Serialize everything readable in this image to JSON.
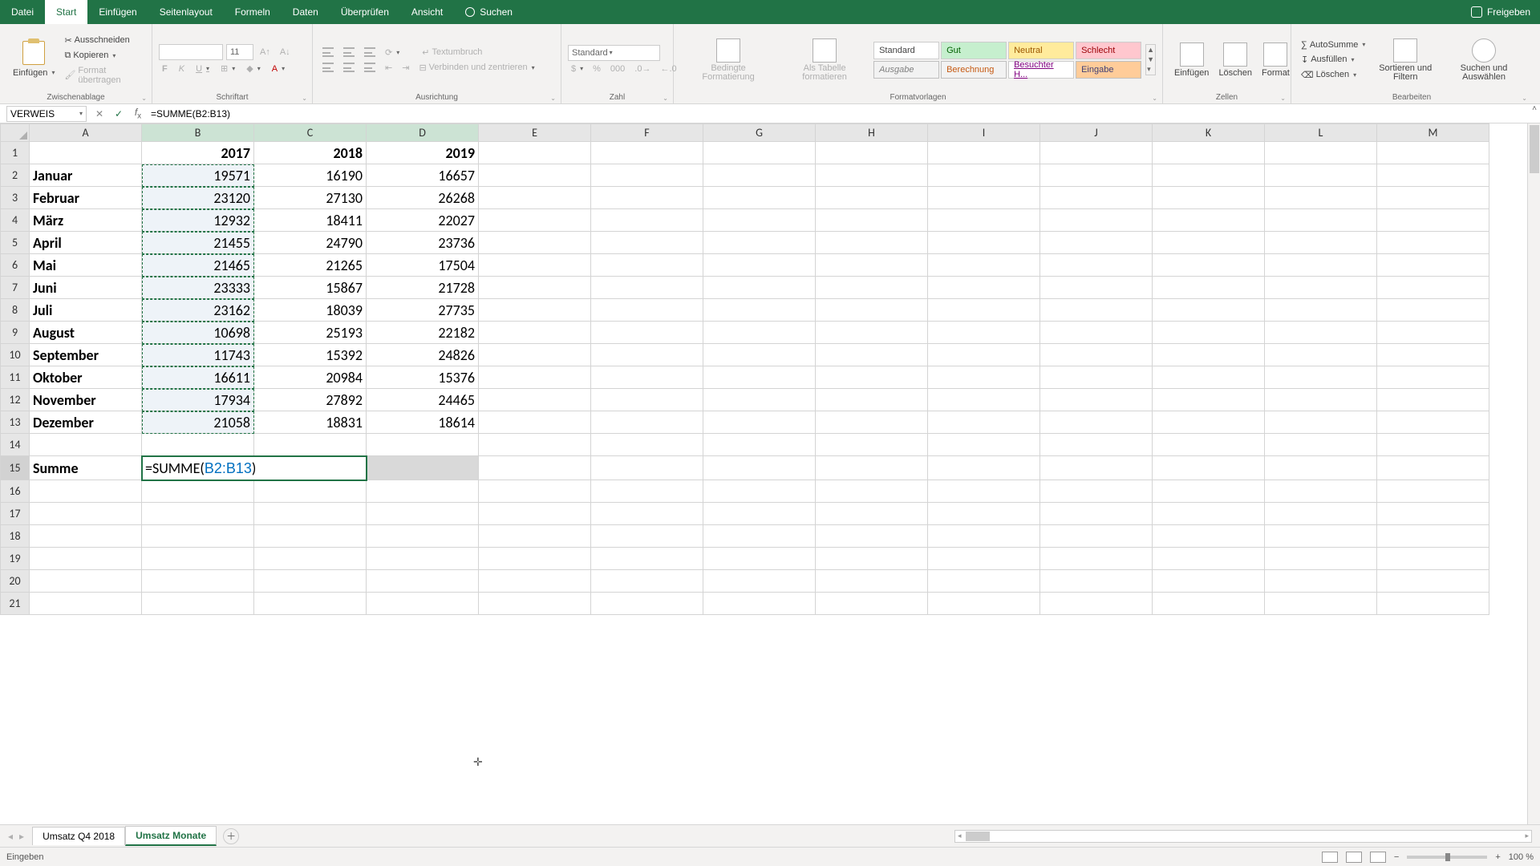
{
  "tabs": {
    "datei": "Datei",
    "start": "Start",
    "einfuegen": "Einfügen",
    "seitenlayout": "Seitenlayout",
    "formeln": "Formeln",
    "daten": "Daten",
    "ueberpruefen": "Überprüfen",
    "ansicht": "Ansicht",
    "suchen": "Suchen",
    "freigeben": "Freigeben"
  },
  "ribbon": {
    "clipboard": {
      "label": "Zwischenablage",
      "paste": "Einfügen",
      "ausschneiden": "Ausschneiden",
      "kopieren": "Kopieren",
      "format_uebertragen": "Format übertragen"
    },
    "font": {
      "label": "Schriftart",
      "size": "11",
      "bold": "F",
      "italic": "K",
      "underline": "U"
    },
    "align": {
      "label": "Ausrichtung",
      "textumbruch": "Textumbruch",
      "verbinden": "Verbinden und zentrieren"
    },
    "number": {
      "label": "Zahl",
      "format": "Standard"
    },
    "styles": {
      "label": "Formatvorlagen",
      "bedingte": "Bedingte Formatierung",
      "als_tabelle": "Als Tabelle formatieren",
      "standard": "Standard",
      "gut": "Gut",
      "neutral": "Neutral",
      "schlecht": "Schlecht",
      "ausgabe": "Ausgabe",
      "berechnung": "Berechnung",
      "besuchter": "Besuchter H...",
      "eingabe": "Eingabe"
    },
    "cells": {
      "label": "Zellen",
      "einfuegen": "Einfügen",
      "loeschen": "Löschen",
      "format": "Format"
    },
    "editing": {
      "label": "Bearbeiten",
      "autosumme": "AutoSumme",
      "ausfuellen": "Ausfüllen",
      "loeschen_btn": "Löschen",
      "sortieren": "Sortieren und Filtern",
      "suchen": "Suchen und Auswählen"
    }
  },
  "name_box": "VERWEIS",
  "formula_bar": "=SUMME(B2:B13)",
  "columns": [
    "A",
    "B",
    "C",
    "D",
    "E",
    "F",
    "G",
    "H",
    "I",
    "J",
    "K",
    "L",
    "M"
  ],
  "chart_data": {
    "type": "table",
    "title": "",
    "headers": {
      "B": 2017,
      "C": 2018,
      "D": 2019
    },
    "rows": [
      {
        "n": 1,
        "A": "",
        "B": "2017",
        "C": "2018",
        "D": "2019",
        "hdr": true
      },
      {
        "n": 2,
        "A": "Januar",
        "B": "19571",
        "C": "16190",
        "D": "16657"
      },
      {
        "n": 3,
        "A": "Februar",
        "B": "23120",
        "C": "27130",
        "D": "26268"
      },
      {
        "n": 4,
        "A": "März",
        "B": "12932",
        "C": "18411",
        "D": "22027"
      },
      {
        "n": 5,
        "A": "April",
        "B": "21455",
        "C": "24790",
        "D": "23736"
      },
      {
        "n": 6,
        "A": "Mai",
        "B": "21465",
        "C": "21265",
        "D": "17504"
      },
      {
        "n": 7,
        "A": "Juni",
        "B": "23333",
        "C": "15867",
        "D": "21728"
      },
      {
        "n": 8,
        "A": "Juli",
        "B": "23162",
        "C": "18039",
        "D": "27735"
      },
      {
        "n": 9,
        "A": "August",
        "B": "10698",
        "C": "25193",
        "D": "22182"
      },
      {
        "n": 10,
        "A": "September",
        "B": "11743",
        "C": "15392",
        "D": "24826"
      },
      {
        "n": 11,
        "A": "Oktober",
        "B": "16611",
        "C": "20984",
        "D": "15376"
      },
      {
        "n": 12,
        "A": "November",
        "B": "17934",
        "C": "27892",
        "D": "24465"
      },
      {
        "n": 13,
        "A": "Dezember",
        "B": "21058",
        "C": "18831",
        "D": "18614"
      }
    ],
    "summe_label": "Summe",
    "formula_prefix": "=SUMME(",
    "formula_ref": "B2:B13",
    "formula_suffix": ")"
  },
  "sheet_tabs": {
    "tab1": "Umsatz Q4 2018",
    "tab2": "Umsatz Monate"
  },
  "status": {
    "mode": "Eingeben",
    "zoom": "100 %"
  }
}
